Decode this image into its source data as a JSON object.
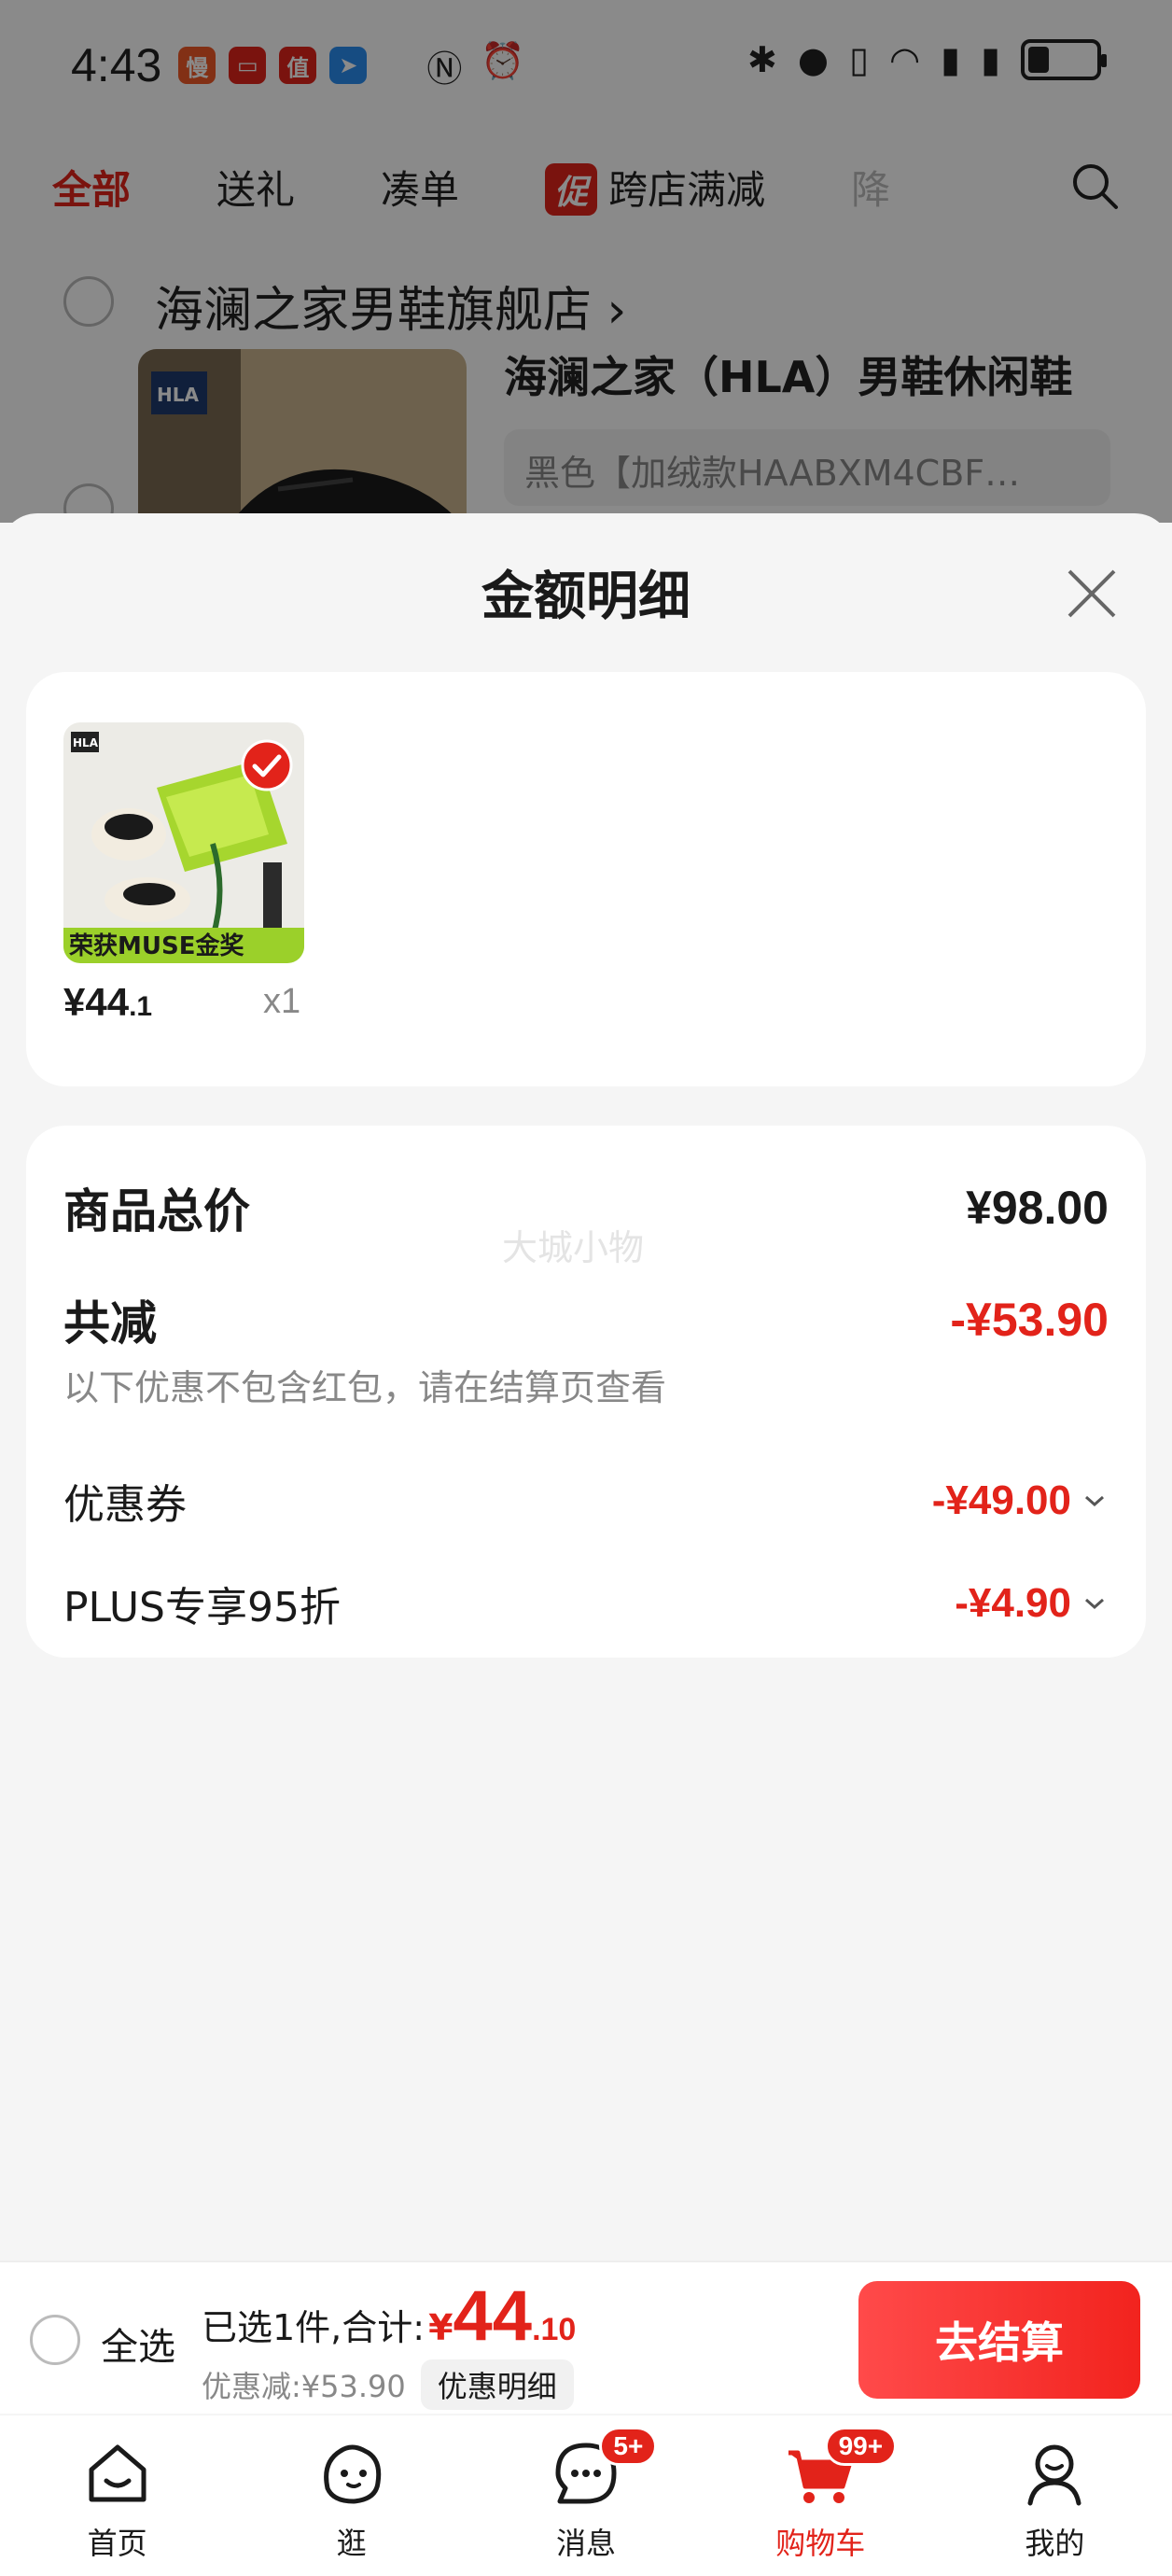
{
  "status_bar": {
    "time": "4:43",
    "apps": [
      {
        "label": "慢",
        "color": "#f05a28"
      },
      {
        "label": "▭",
        "color": "#e2231a"
      },
      {
        "label": "值",
        "color": "#e2231a"
      },
      {
        "label": "➤",
        "color": "#2a8cf0"
      }
    ]
  },
  "top_tabs": {
    "items": [
      "全部",
      "送礼",
      "凑单"
    ],
    "promo_tag": "促",
    "promo_label": "跨店满减",
    "cut_label": "降"
  },
  "background_cart": {
    "shop_name": "海澜之家男鞋旗舰店",
    "shop_chevron": "›",
    "product_title": "海澜之家（HLA）男鞋休闲鞋",
    "variant": "黑色【加绒款HAABXM4CBF…"
  },
  "sheet": {
    "title": "金额明细",
    "product": {
      "price_int": "¥44",
      "price_dec": ".1",
      "qty": "x1",
      "img_caption": "荣获MUSE金奖"
    },
    "summary": {
      "total_label": "商品总价",
      "total_value": "¥98.00",
      "reduce_label": "共减",
      "reduce_value": "-¥53.90",
      "note": "以下优惠不包含红包，请在结算页查看",
      "watermark": "大城小物",
      "lines": [
        {
          "label": "优惠券",
          "value": "-¥49.00"
        },
        {
          "label": "PLUS专享95折",
          "value": "-¥4.90"
        }
      ]
    }
  },
  "checkout": {
    "select_all": "全选",
    "selected_text": "已选1件,合计:",
    "currency": "¥",
    "total_int": "44",
    "total_dec": ".10",
    "discount_text": "优惠减:¥53.90",
    "detail_button": "优惠明细",
    "pay_button": "去结算"
  },
  "bottom_nav": {
    "items": [
      {
        "label": "首页",
        "icon": "home-icon"
      },
      {
        "label": "逛",
        "icon": "browse-icon"
      },
      {
        "label": "消息",
        "icon": "message-icon",
        "badge": "5+"
      },
      {
        "label": "购物车",
        "icon": "cart-icon",
        "badge": "99+",
        "active": true
      },
      {
        "label": "我的",
        "icon": "profile-icon"
      }
    ]
  },
  "colors": {
    "accent": "#e2231a",
    "background": "#f5f5f5"
  }
}
